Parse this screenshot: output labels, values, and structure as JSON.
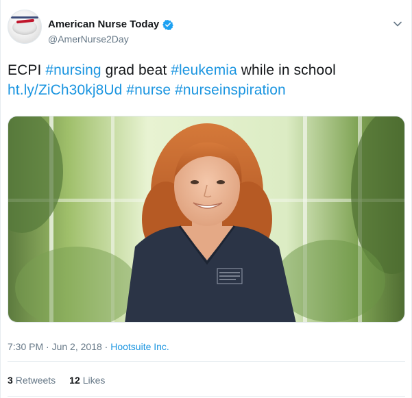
{
  "account": {
    "display_name": "American Nurse Today",
    "handle": "@AmerNurse2Day",
    "verified": true
  },
  "tweet": {
    "segments": [
      {
        "text": "ECPI ",
        "link": false
      },
      {
        "text": "#nursing",
        "link": true
      },
      {
        "text": " grad beat ",
        "link": false
      },
      {
        "text": "#leukemia",
        "link": true
      },
      {
        "text": " while in school",
        "link": false
      }
    ],
    "line2": [
      {
        "text": "ht.ly/ZiCh30kj8Ud",
        "link": true
      },
      {
        "text": " ",
        "link": false
      },
      {
        "text": "#nurse",
        "link": true
      },
      {
        "text": " ",
        "link": false
      },
      {
        "text": "#nurseinspiration",
        "link": true
      }
    ]
  },
  "meta": {
    "time": "7:30 PM",
    "separator": "·",
    "date": "Jun 2, 2018",
    "separator2": "·",
    "source": "Hootsuite Inc."
  },
  "stats": {
    "retweets_count": "3",
    "retweets_label": "Retweets",
    "likes_count": "12",
    "likes_label": "Likes"
  },
  "icons": {
    "verified": "verified-badge-icon",
    "caret": "chevron-down-icon",
    "avatar": "avatar-logo"
  },
  "colors": {
    "link": "#1b95e0",
    "text": "#14171a",
    "muted": "#657786",
    "verified": "#1da1f2",
    "scrubs": "#2b3446",
    "hair": "#c4622b"
  }
}
